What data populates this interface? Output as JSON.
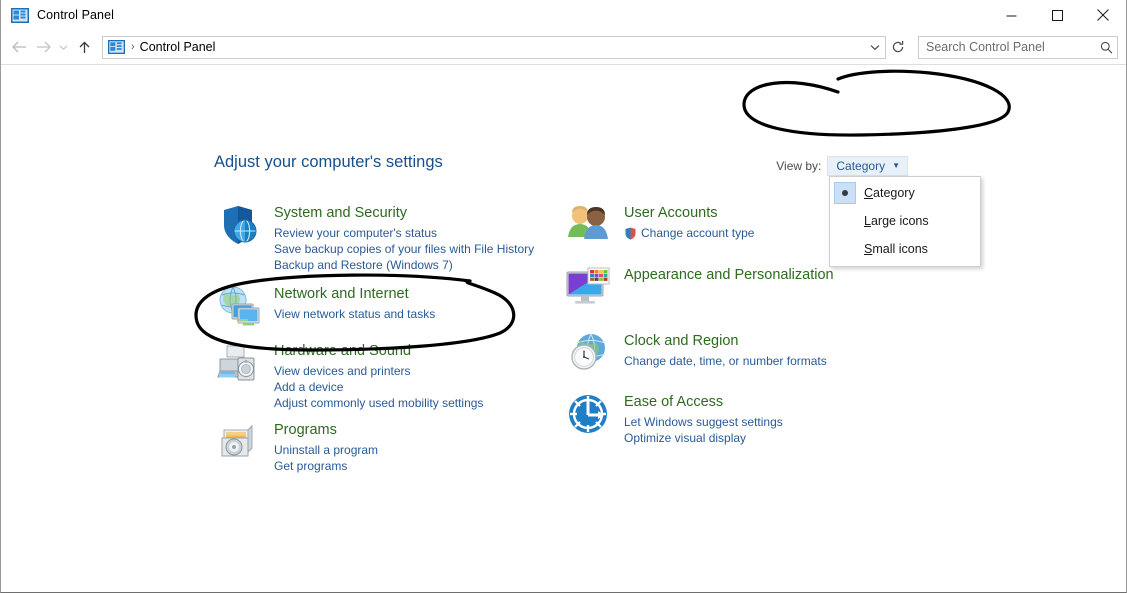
{
  "window": {
    "title": "Control Panel",
    "icon": "control-panel-icon",
    "caption_buttons": {
      "minimize": "minimize-icon",
      "maximize": "maximize-icon",
      "close": "close-icon"
    }
  },
  "navbar": {
    "back": "back-arrow-icon",
    "forward": "forward-arrow-icon",
    "recent": "recent-locations-chevron-icon",
    "up": "up-arrow-icon",
    "breadcrumb": {
      "icon": "control-panel-icon",
      "separator": "›",
      "text": "Control Panel"
    },
    "address_dropdown": "chevron-down-icon",
    "refresh": "refresh-icon",
    "search": {
      "value": "",
      "placeholder": "Search Control Panel",
      "icon": "search-icon"
    }
  },
  "main": {
    "page_title": "Adjust your computer's settings",
    "view_by": {
      "label": "View by:",
      "value": "Category",
      "caret": "▼",
      "open": true,
      "options": [
        {
          "label": "Category",
          "accel": "C",
          "selected": true
        },
        {
          "label": "Large icons",
          "accel": "L",
          "selected": false
        },
        {
          "label": "Small icons",
          "accel": "S",
          "selected": false
        }
      ]
    },
    "columns": [
      {
        "name": "left-column",
        "categories": [
          {
            "title": "System and Security",
            "icon": "shield-globe-icon",
            "links": [
              "Review your computer's status",
              "Save backup copies of your files with File History",
              "Backup and Restore (Windows 7)"
            ]
          },
          {
            "title": "Network and Internet",
            "icon": "globe-monitors-icon",
            "links": [
              "View network status and tasks"
            ]
          },
          {
            "title": "Hardware and Sound",
            "icon": "printer-speaker-icon",
            "links": [
              "View devices and printers",
              "Add a device",
              "Adjust commonly used mobility settings"
            ]
          },
          {
            "title": "Programs",
            "icon": "program-disc-icon",
            "links": [
              "Uninstall a program",
              "Get programs"
            ]
          }
        ]
      },
      {
        "name": "right-column",
        "categories": [
          {
            "title": "User Accounts",
            "icon": "two-users-icon",
            "links": [
              {
                "text": "Change account type",
                "badge": "uac-shield-icon"
              }
            ]
          },
          {
            "title": "Appearance and Personalization",
            "icon": "monitor-palette-icon",
            "links": []
          },
          {
            "title": "Clock and Region",
            "icon": "globe-clock-icon",
            "links": [
              "Change date, time, or number formats"
            ]
          },
          {
            "title": "Ease of Access",
            "icon": "ease-of-access-icon",
            "links": [
              "Let Windows suggest settings",
              "Optimize visual display"
            ]
          }
        ]
      }
    ]
  },
  "annotations": [
    {
      "name": "ellipse-around-view-by",
      "shape": "hand-drawn-ellipse",
      "color": "#000000"
    },
    {
      "name": "ellipse-around-hardware-and-sound",
      "shape": "hand-drawn-ellipse",
      "color": "#000000"
    }
  ],
  "colors": {
    "category_title": "#2d6b1f",
    "link": "#2a5a96",
    "page_title": "#17508c",
    "annotation": "#000000",
    "highlight": "#cce0f5"
  }
}
